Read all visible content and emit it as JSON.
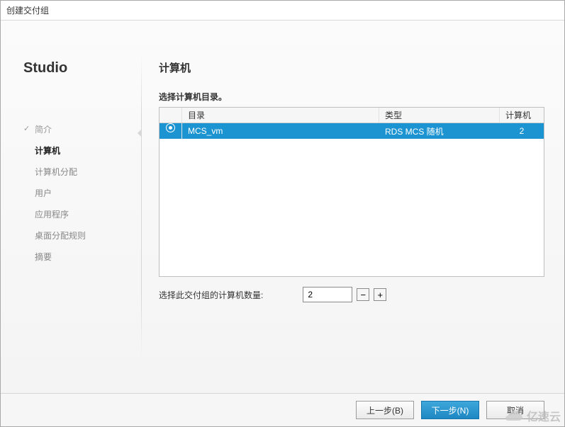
{
  "window": {
    "title": "创建交付组"
  },
  "sidebar": {
    "brand": "Studio",
    "items": [
      {
        "label": "简介",
        "state": "done"
      },
      {
        "label": "计算机",
        "state": "current"
      },
      {
        "label": "计算机分配",
        "state": "pending"
      },
      {
        "label": "用户",
        "state": "pending"
      },
      {
        "label": "应用程序",
        "state": "pending"
      },
      {
        "label": "桌面分配规则",
        "state": "pending"
      },
      {
        "label": "摘要",
        "state": "pending"
      }
    ]
  },
  "page": {
    "heading": "计算机",
    "instruction": "选择计算机目录。"
  },
  "table": {
    "headers": {
      "catalog": "目录",
      "type": "类型",
      "count": "计算机"
    },
    "rows": [
      {
        "catalog": "MCS_vm",
        "type": "RDS MCS 随机",
        "count": "2",
        "selected": true
      }
    ]
  },
  "quantity": {
    "label": "选择此交付组的计算机数量:",
    "value": "2"
  },
  "buttons": {
    "back": "上一步(B)",
    "next": "下一步(N)",
    "cancel": "取消"
  },
  "watermark": "亿速云"
}
